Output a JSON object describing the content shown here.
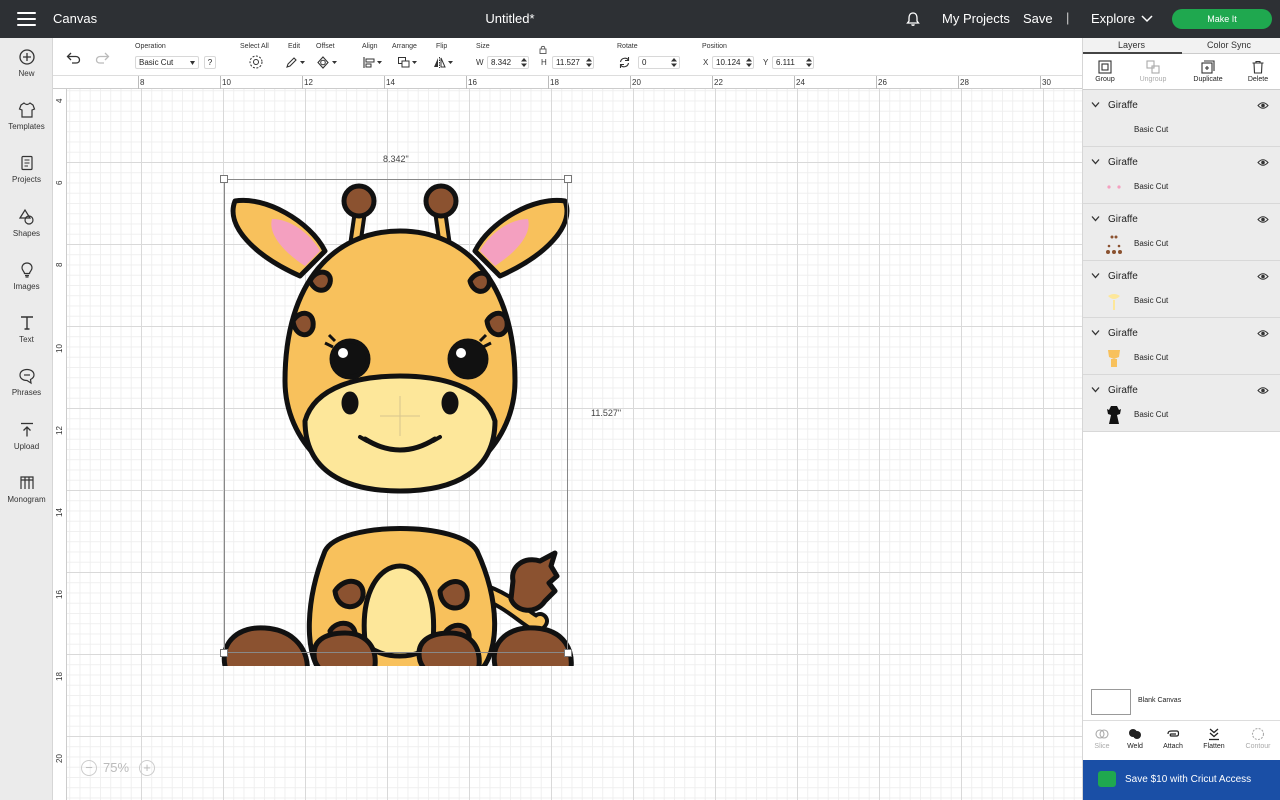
{
  "topbar": {
    "app_title": "Canvas",
    "doc_title": "Untitled*",
    "my_projects": "My Projects",
    "save": "Save",
    "separator": "|",
    "explore": "Explore",
    "make_it": "Make It"
  },
  "sidebar": {
    "items": [
      {
        "label": "New",
        "icon": "plus-circle-icon"
      },
      {
        "label": "Templates",
        "icon": "shirt-icon"
      },
      {
        "label": "Projects",
        "icon": "projects-icon"
      },
      {
        "label": "Shapes",
        "icon": "shapes-icon"
      },
      {
        "label": "Images",
        "icon": "bulb-icon"
      },
      {
        "label": "Text",
        "icon": "text-icon"
      },
      {
        "label": "Phrases",
        "icon": "speech-bubble-icon"
      },
      {
        "label": "Upload",
        "icon": "upload-icon"
      },
      {
        "label": "Monogram",
        "icon": "monogram-icon"
      }
    ]
  },
  "toolbar": {
    "operation_label": "Operation",
    "operation_value": "Basic Cut",
    "operation_help": "?",
    "select_all_label": "Select All",
    "edit_label": "Edit",
    "offset_label": "Offset",
    "align_label": "Align",
    "arrange_label": "Arrange",
    "flip_label": "Flip",
    "size_label": "Size",
    "w_label": "W",
    "w_value": "8.342",
    "h_label": "H",
    "h_value": "11.527",
    "rotate_label": "Rotate",
    "rotate_value": "0",
    "position_label": "Position",
    "x_label": "X",
    "x_value": "10.124",
    "y_label": "Y",
    "y_value": "6.111"
  },
  "ruler_top": [
    "8",
    "10",
    "12",
    "14",
    "16",
    "18",
    "20",
    "22",
    "24",
    "26",
    "28",
    "30"
  ],
  "ruler_left": [
    "4",
    "6",
    "8",
    "10",
    "12",
    "14",
    "16",
    "18",
    "20"
  ],
  "canvas": {
    "width_label": "8.342\"",
    "height_label": "11.527\"",
    "zoom": "75%",
    "zoom_minus": "−",
    "zoom_plus": "+"
  },
  "right_panel": {
    "tabs": [
      "Layers",
      "Color Sync"
    ],
    "actions": [
      {
        "label": "Group",
        "icon": "group-icon",
        "enabled": true
      },
      {
        "label": "Ungroup",
        "icon": "ungroup-icon",
        "enabled": false
      },
      {
        "label": "Duplicate",
        "icon": "duplicate-icon",
        "enabled": true
      },
      {
        "label": "Delete",
        "icon": "trash-icon",
        "enabled": true
      }
    ],
    "layers": [
      {
        "name": "Giraffe",
        "operation": "Basic Cut",
        "thumb_color": "#ececec"
      },
      {
        "name": "Giraffe",
        "operation": "Basic Cut",
        "thumb_color": "#f4a0c0"
      },
      {
        "name": "Giraffe",
        "operation": "Basic Cut",
        "thumb_color": "#8b5230"
      },
      {
        "name": "Giraffe",
        "operation": "Basic Cut",
        "thumb_color": "#fde79a"
      },
      {
        "name": "Giraffe",
        "operation": "Basic Cut",
        "thumb_color": "#f8c15c"
      },
      {
        "name": "Giraffe",
        "operation": "Basic Cut",
        "thumb_color": "#111111"
      }
    ],
    "blank_canvas": "Blank Canvas",
    "bottom_actions": [
      {
        "label": "Slice",
        "enabled": false
      },
      {
        "label": "Weld",
        "enabled": true
      },
      {
        "label": "Attach",
        "enabled": true
      },
      {
        "label": "Flatten",
        "enabled": true
      },
      {
        "label": "Contour",
        "enabled": false
      }
    ],
    "promo": "Save $10 with Cricut Access"
  },
  "colors": {
    "topbar": "#2d3034",
    "make_it": "#1fa84f",
    "promo": "#1a4fa6",
    "giraffe_body": "#f8c15c",
    "giraffe_muzzle": "#fde79a",
    "giraffe_spots": "#8b5230",
    "giraffe_ear": "#f4a0c0"
  }
}
